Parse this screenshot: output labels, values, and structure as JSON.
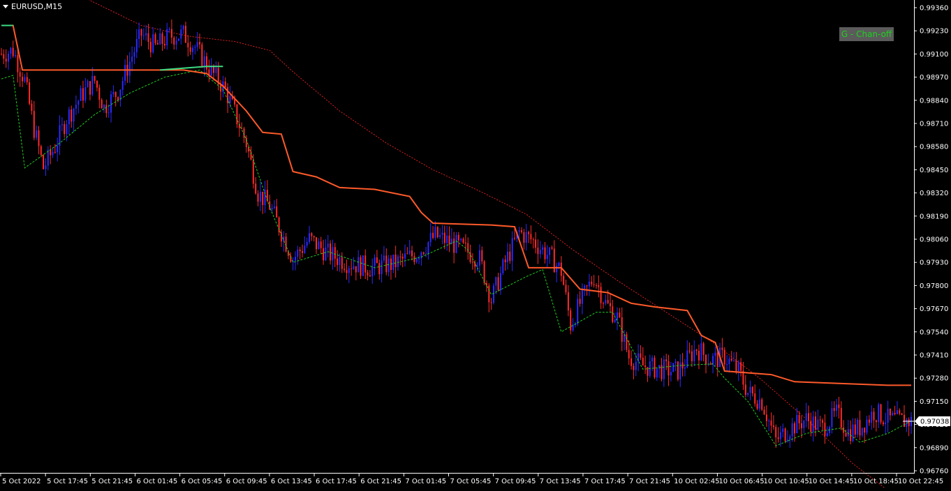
{
  "header": {
    "symbol_title": "EURUSD,M15"
  },
  "indicator": {
    "badge_label": "G - Chan-off"
  },
  "colors": {
    "background": "#000000",
    "axis": "#ffffff",
    "bull_candle": "#2b2bff",
    "bear_candle": "#ff2b2b",
    "upper_band": "#ff5a2a",
    "upper_band_alt": "#3ddc84",
    "lower_band": "#1fcf1f",
    "long_ma": "#e02020",
    "price_tag_bg": "#ffffff",
    "price_tag_text": "#000000"
  },
  "chart_data": {
    "type": "line",
    "y_ticks": [
      "0.99360",
      "0.99230",
      "0.99100",
      "0.98970",
      "0.98840",
      "0.98710",
      "0.98580",
      "0.98450",
      "0.98320",
      "0.98190",
      "0.98060",
      "0.97930",
      "0.97800",
      "0.97670",
      "0.97540",
      "0.97410",
      "0.97280",
      "0.97150",
      "0.97020",
      "0.96890",
      "0.96760"
    ],
    "ylim": [
      0.9676,
      0.9936
    ],
    "x_ticks": [
      "5 Oct 2022",
      "5 Oct 17:45",
      "5 Oct 21:45",
      "6 Oct 01:45",
      "6 Oct 05:45",
      "6 Oct 09:45",
      "6 Oct 13:45",
      "6 Oct 17:45",
      "6 Oct 21:45",
      "7 Oct 01:45",
      "7 Oct 05:45",
      "7 Oct 09:45",
      "7 Oct 13:45",
      "7 Oct 17:45",
      "7 Oct 21:45",
      "10 Oct 02:45",
      "10 Oct 06:45",
      "10 Oct 10:45",
      "10 Oct 14:45",
      "10 Oct 18:45",
      "10 Oct 22:45"
    ],
    "current_price": "0.97038",
    "price_path": [
      [
        0,
        0.991
      ],
      [
        5,
        0.9912
      ],
      [
        10,
        0.9895
      ],
      [
        14,
        0.9868
      ],
      [
        18,
        0.9846
      ],
      [
        23,
        0.9858
      ],
      [
        28,
        0.9874
      ],
      [
        35,
        0.9888
      ],
      [
        40,
        0.9895
      ],
      [
        44,
        0.988
      ],
      [
        50,
        0.9889
      ],
      [
        56,
        0.9909
      ],
      [
        60,
        0.9921
      ],
      [
        66,
        0.9914
      ],
      [
        72,
        0.992
      ],
      [
        78,
        0.9921
      ],
      [
        83,
        0.9914
      ],
      [
        90,
        0.99
      ],
      [
        96,
        0.989
      ],
      [
        100,
        0.9877
      ],
      [
        105,
        0.986
      ],
      [
        110,
        0.9832
      ],
      [
        115,
        0.9825
      ],
      [
        120,
        0.981
      ],
      [
        125,
        0.9795
      ],
      [
        132,
        0.9806
      ],
      [
        140,
        0.9798
      ],
      [
        148,
        0.9793
      ],
      [
        158,
        0.979
      ],
      [
        168,
        0.9792
      ],
      [
        178,
        0.9798
      ],
      [
        186,
        0.9808
      ],
      [
        196,
        0.9802
      ],
      [
        205,
        0.9795
      ],
      [
        210,
        0.9772
      ],
      [
        216,
        0.9793
      ],
      [
        222,
        0.981
      ],
      [
        228,
        0.9805
      ],
      [
        236,
        0.9795
      ],
      [
        240,
        0.9788
      ],
      [
        244,
        0.9758
      ],
      [
        248,
        0.977
      ],
      [
        254,
        0.9785
      ],
      [
        259,
        0.977
      ],
      [
        264,
        0.9762
      ],
      [
        269,
        0.974
      ],
      [
        275,
        0.9735
      ],
      [
        282,
        0.9733
      ],
      [
        290,
        0.9732
      ],
      [
        298,
        0.9745
      ],
      [
        304,
        0.9738
      ],
      [
        310,
        0.974
      ],
      [
        316,
        0.9732
      ],
      [
        320,
        0.972
      ],
      [
        326,
        0.9715
      ],
      [
        332,
        0.9693
      ],
      [
        338,
        0.97
      ],
      [
        345,
        0.9705
      ],
      [
        352,
        0.97
      ],
      [
        358,
        0.9708
      ],
      [
        363,
        0.9698
      ],
      [
        368,
        0.97
      ],
      [
        374,
        0.9709
      ],
      [
        380,
        0.9705
      ],
      [
        386,
        0.9704
      ],
      [
        390,
        0.97038
      ]
    ],
    "upper_band": [
      [
        0,
        0.9926
      ],
      [
        5,
        0.9926
      ],
      [
        9,
        0.9901
      ],
      [
        68,
        0.9901
      ],
      [
        78,
        0.9901
      ],
      [
        88,
        0.9899
      ],
      [
        95,
        0.9892
      ],
      [
        105,
        0.9878
      ],
      [
        112,
        0.9866
      ],
      [
        120,
        0.9865
      ],
      [
        125,
        0.9844
      ],
      [
        135,
        0.9841
      ],
      [
        145,
        0.9835
      ],
      [
        160,
        0.9834
      ],
      [
        175,
        0.983
      ],
      [
        180,
        0.9821
      ],
      [
        185,
        0.9815
      ],
      [
        210,
        0.9814
      ],
      [
        220,
        0.9813
      ],
      [
        226,
        0.979
      ],
      [
        240,
        0.979
      ],
      [
        248,
        0.9778
      ],
      [
        260,
        0.9776
      ],
      [
        270,
        0.977
      ],
      [
        280,
        0.9768
      ],
      [
        294,
        0.9766
      ],
      [
        300,
        0.9752
      ],
      [
        306,
        0.9748
      ],
      [
        310,
        0.9732
      ],
      [
        330,
        0.973
      ],
      [
        340,
        0.9726
      ],
      [
        360,
        0.9725
      ],
      [
        380,
        0.9724
      ],
      [
        390,
        0.9724
      ]
    ],
    "lower_band": [
      [
        0,
        0.9896
      ],
      [
        5,
        0.9898
      ],
      [
        10,
        0.9846
      ],
      [
        25,
        0.986
      ],
      [
        40,
        0.9876
      ],
      [
        55,
        0.9888
      ],
      [
        70,
        0.9897
      ],
      [
        85,
        0.9901
      ],
      [
        95,
        0.989
      ],
      [
        105,
        0.9862
      ],
      [
        115,
        0.9824
      ],
      [
        125,
        0.9793
      ],
      [
        140,
        0.9799
      ],
      [
        160,
        0.979
      ],
      [
        180,
        0.9796
      ],
      [
        195,
        0.9805
      ],
      [
        200,
        0.98
      ],
      [
        210,
        0.9775
      ],
      [
        225,
        0.9785
      ],
      [
        232,
        0.9789
      ],
      [
        240,
        0.9754
      ],
      [
        255,
        0.9765
      ],
      [
        262,
        0.9765
      ],
      [
        275,
        0.9733
      ],
      [
        290,
        0.9735
      ],
      [
        305,
        0.9736
      ],
      [
        310,
        0.9728
      ],
      [
        320,
        0.9715
      ],
      [
        332,
        0.969
      ],
      [
        345,
        0.9697
      ],
      [
        360,
        0.97
      ],
      [
        368,
        0.9692
      ],
      [
        380,
        0.9697
      ],
      [
        390,
        0.9704
      ]
    ],
    "long_ma": [
      [
        35,
        0.9942
      ],
      [
        60,
        0.9926
      ],
      [
        80,
        0.992
      ],
      [
        100,
        0.9917
      ],
      [
        115,
        0.9912
      ],
      [
        125,
        0.99
      ],
      [
        145,
        0.9878
      ],
      [
        165,
        0.986
      ],
      [
        185,
        0.9845
      ],
      [
        205,
        0.9833
      ],
      [
        225,
        0.982
      ],
      [
        245,
        0.98
      ],
      [
        265,
        0.9782
      ],
      [
        285,
        0.9765
      ],
      [
        305,
        0.9748
      ],
      [
        325,
        0.9728
      ],
      [
        345,
        0.9705
      ],
      [
        365,
        0.968
      ],
      [
        390,
        0.9655
      ]
    ],
    "title": "EURUSD,M15",
    "xlabel": "",
    "ylabel": ""
  }
}
